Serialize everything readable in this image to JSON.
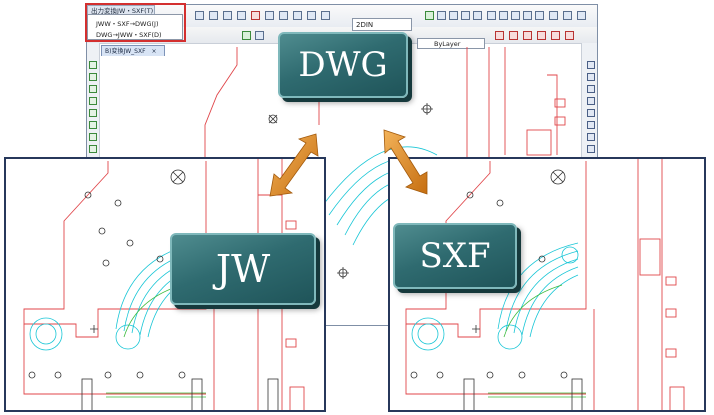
{
  "menu": {
    "header": "出力変換JW・SXF(T)",
    "items": [
      "JWW・SXF→DWG(J)",
      "DWG→JWW・SXF(D)"
    ]
  },
  "toolbar": {
    "view_mode": "2DIN",
    "layer_value": "ByLayer"
  },
  "document_tab": {
    "label": "B)変換JW_SXF",
    "close_glyph": "×"
  },
  "labels": {
    "dwg": "DWG",
    "jw": "JW",
    "sxf": "SXF"
  },
  "colors": {
    "highlight": "#d32f2f",
    "tag_fill": "#2f6b70",
    "arrow": "#e08a1e",
    "cad_red": "#e0464a",
    "cad_cyan": "#19c6d6",
    "cad_green": "#3dbb3d",
    "panel_border": "#27385b"
  }
}
